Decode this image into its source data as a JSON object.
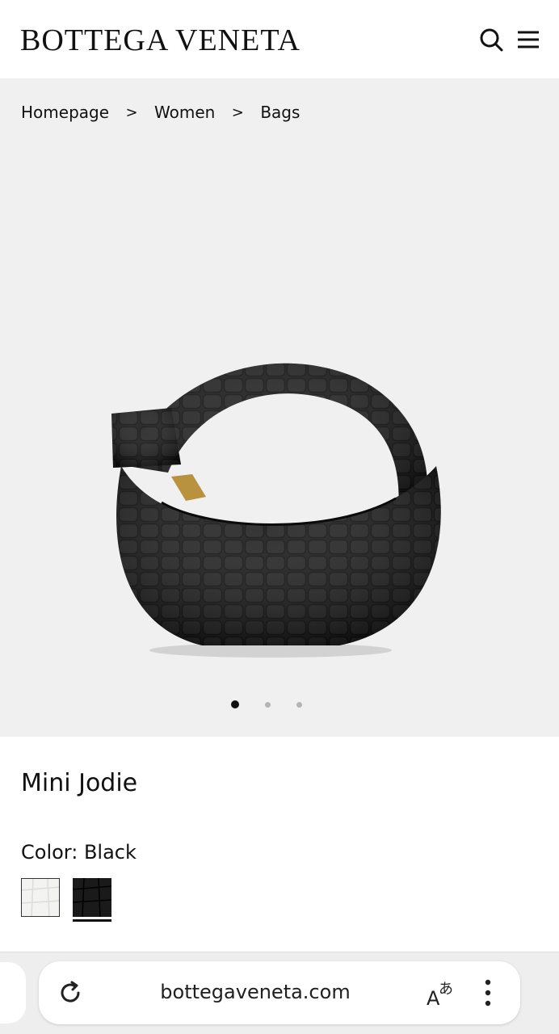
{
  "header": {
    "logo_text": "BOTTEGA VENETA",
    "icons": [
      "search-icon",
      "menu-icon"
    ]
  },
  "breadcrumb": {
    "items": [
      "Homepage",
      "Women",
      "Bags"
    ],
    "separator": ">"
  },
  "gallery": {
    "background": "#eff0ef",
    "image": "black-croc-mini-jodie-bag",
    "slide_count": 3,
    "active_slide": 1
  },
  "product": {
    "title": "Mini Jodie",
    "color_label": "Color:",
    "color_value": "Black",
    "swatches": [
      {
        "name": "white",
        "hex": "#f3f3f1",
        "selected": false
      },
      {
        "name": "black",
        "hex": "#1a1a1a",
        "selected": true
      }
    ]
  },
  "browser": {
    "url": "bottegaveneta.com",
    "icons": [
      "reload-icon",
      "translate-icon",
      "more-vert-icon"
    ]
  }
}
